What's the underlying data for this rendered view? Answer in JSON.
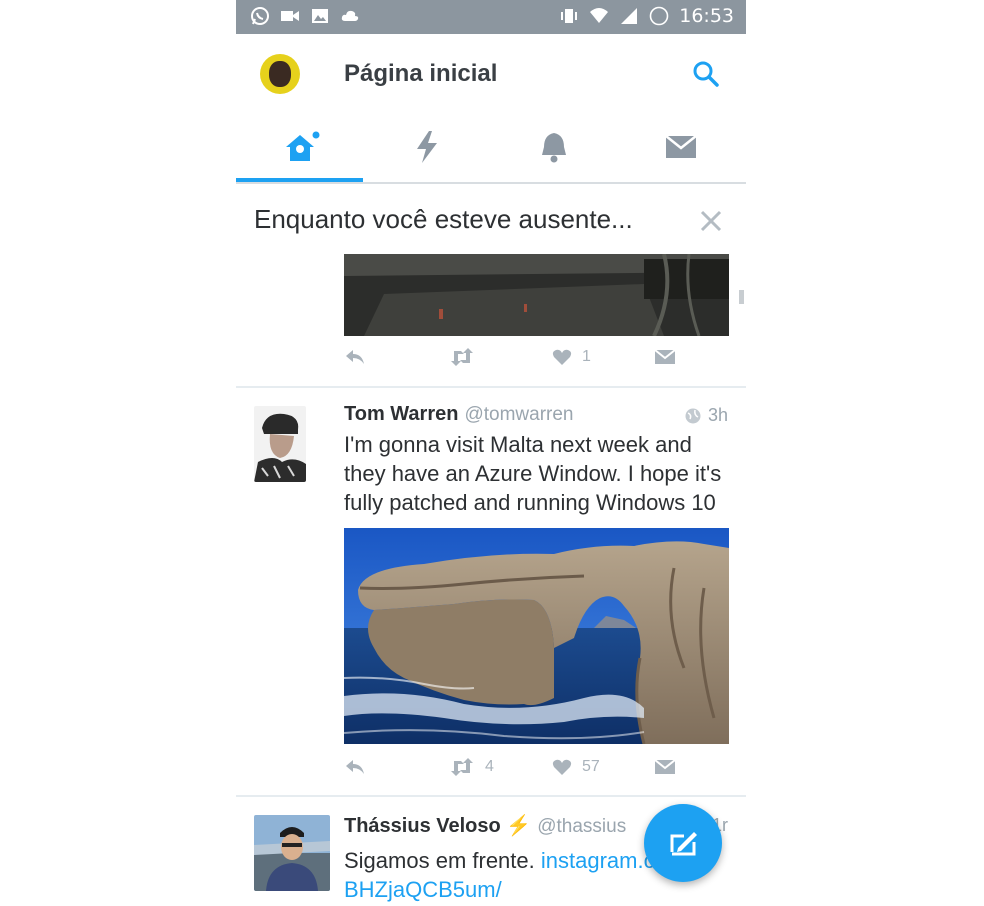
{
  "status_bar": {
    "time": "16:53",
    "battery": "78",
    "left_icons": [
      "whatsapp-icon",
      "video-icon",
      "image-icon",
      "cloud-icon"
    ],
    "right_icons": [
      "vibrate-icon",
      "wifi-icon",
      "signal-icon",
      "battery-icon"
    ]
  },
  "header": {
    "title": "Página inicial"
  },
  "tabs": [
    {
      "icon": "home-icon",
      "active": true,
      "has_dot": true
    },
    {
      "icon": "moments-icon",
      "active": false
    },
    {
      "icon": "notifications-icon",
      "active": false
    },
    {
      "icon": "messages-icon",
      "active": false
    }
  ],
  "away_banner": {
    "text": "Enquanto você esteve ausente..."
  },
  "tweet_prev": {
    "likes": "1"
  },
  "tweet_1": {
    "name": "Tom Warren",
    "handle": "@tomwarren",
    "time": "3h",
    "text_lines": [
      "I'm gonna visit Malta next week and",
      "they have an Azure Window. I hope it's",
      "fully patched and running Windows 10"
    ],
    "retweets": "4",
    "likes": "57"
  },
  "tweet_2": {
    "name": "Thássius Veloso",
    "verified_symbol": "⚡",
    "handle": "@thassius",
    "time": "1r",
    "text_prefix": "Sigamos em frente. ",
    "link_part1": "instagram.com/p/",
    "link_part2": "BHZjaQCB5um/"
  },
  "colors": {
    "accent": "#1da1f2",
    "status_bar": "#8c969f",
    "muted": "#aab3bb"
  }
}
